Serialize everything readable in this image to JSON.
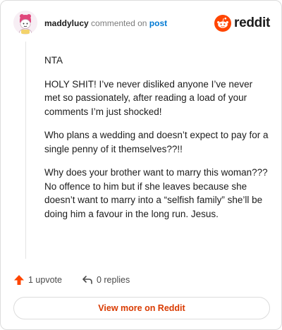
{
  "header": {
    "username": "maddylucy",
    "commented_on": "commented on",
    "post_link": "post",
    "brand": "reddit"
  },
  "comment": {
    "paragraphs": [
      "NTA",
      "HOLY SHIT! I’ve never disliked anyone I’ve never met so passionately, after reading a load of your comments I’m just shocked!",
      "Who plans a wedding and doesn’t expect to pay for a single penny of it themselves??!!",
      "Why does your brother want to marry this woman??? No offence to him but if she leaves because she doesn’t want to marry into a “selfish family” she’ll be doing him a favour in the long run. Jesus."
    ]
  },
  "actions": {
    "upvotes": "1 upvote",
    "replies": "0 replies"
  },
  "footer": {
    "view_more": "View more on Reddit"
  },
  "colors": {
    "brand_orange": "#ff4500",
    "link_blue": "#0079d3",
    "cta_text": "#d93a00"
  }
}
